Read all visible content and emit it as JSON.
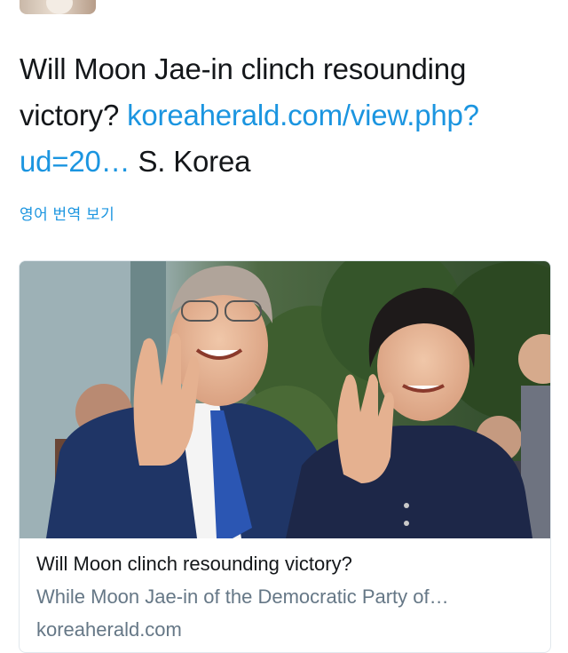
{
  "tweet": {
    "text_plain_1": "Will Moon Jae-in clinch resounding victory? ",
    "link_text": "koreaherald.com/view.php?ud=20…",
    "text_plain_2": " S. Korea",
    "translate_label": "영어 번역 보기"
  },
  "card": {
    "image_icon": "photo-moon-jae-in-and-wife-waving",
    "title": "Will Moon clinch resounding victory?",
    "description": "While Moon Jae-in of the Democratic Party of…",
    "domain": "koreaherald.com"
  },
  "colors": {
    "link": "#1b95e0",
    "text": "#14171a",
    "muted": "#657786",
    "card_border": "#e1e8ed"
  }
}
